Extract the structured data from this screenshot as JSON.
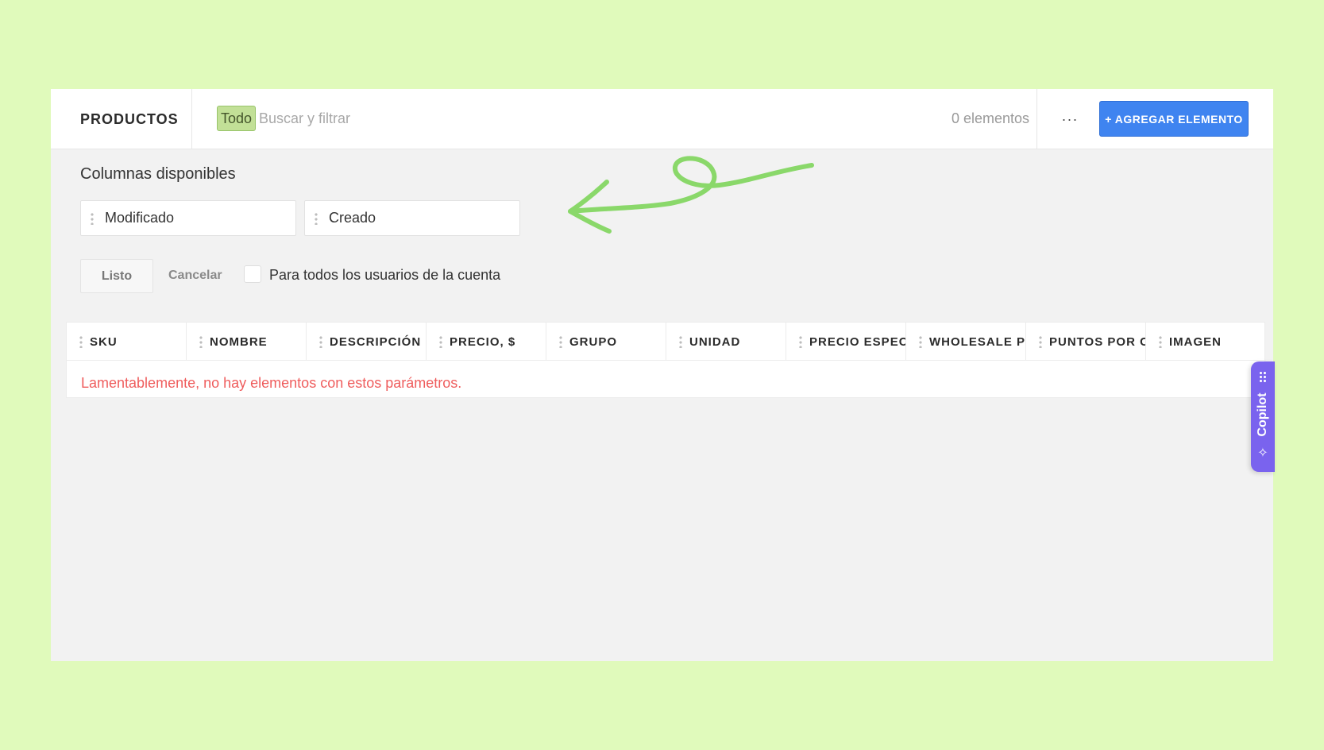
{
  "header": {
    "title": "PRODUCTOS",
    "filter_chip": "Todo",
    "search_placeholder": "Buscar y filtrar",
    "count": "0 elementos",
    "more_label": "···",
    "add_button": "+ AGREGAR ELEMENTO"
  },
  "columns_panel": {
    "title": "Columnas disponibles",
    "available": [
      "Modificado",
      "Creado"
    ],
    "done_button": "Listo",
    "cancel_button": "Cancelar",
    "all_users_label": "Para todos los usuarios de la cuenta"
  },
  "table": {
    "columns": [
      "SKU",
      "NOMBRE",
      "DESCRIPCIÓN",
      "PRECIO, $",
      "GRUPO",
      "UNIDAD",
      "PRECIO ESPECIAL",
      "WHOLESALE PRICE",
      "PUNTOS POR COMPRA",
      "IMAGEN"
    ],
    "empty_message": "Lamentablemente, no hay elementos con estos parámetros."
  },
  "copilot": {
    "label": "Copilot",
    "sparkle_icon": "✧"
  },
  "colors": {
    "background": "#e0fabb",
    "accent": "#3f84f0",
    "error": "#ef5d5d",
    "copilot": "#7a63ee",
    "annotation": "#8ad86a"
  }
}
